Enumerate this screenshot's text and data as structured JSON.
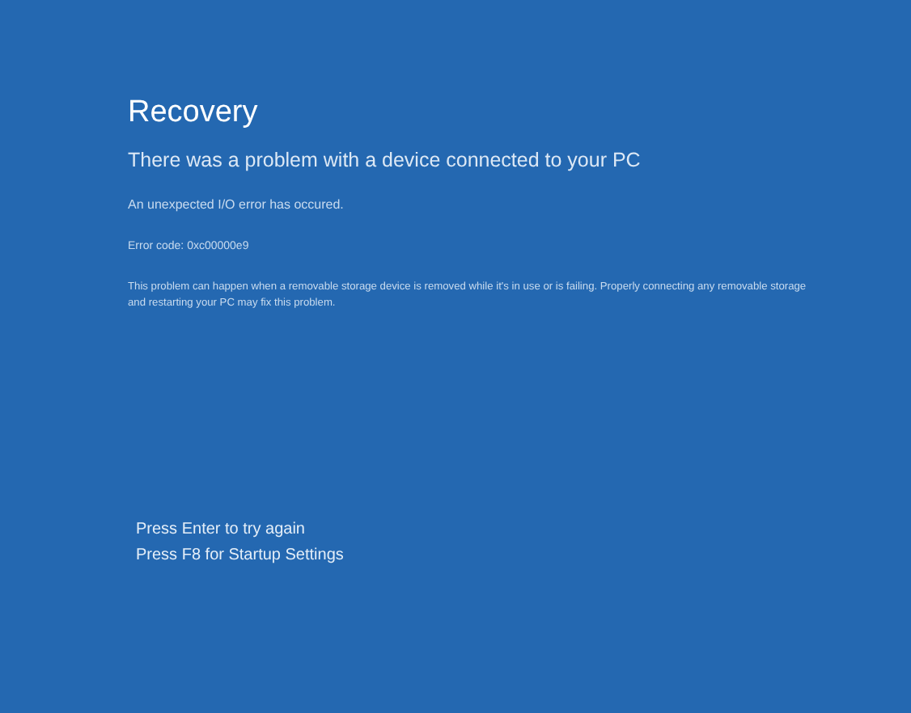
{
  "title": "Recovery",
  "heading": "There was a problem with a device connected to your PC",
  "message": "An unexpected I/O error has occured.",
  "error_code": "Error code: 0xc00000e9",
  "description": "This problem can happen when a removable storage device is removed while it's in use or is failing. Properly connecting any removable storage and restarting your PC may fix this problem.",
  "options": [
    "Press Enter to try again",
    "Press F8 for Startup Settings"
  ]
}
